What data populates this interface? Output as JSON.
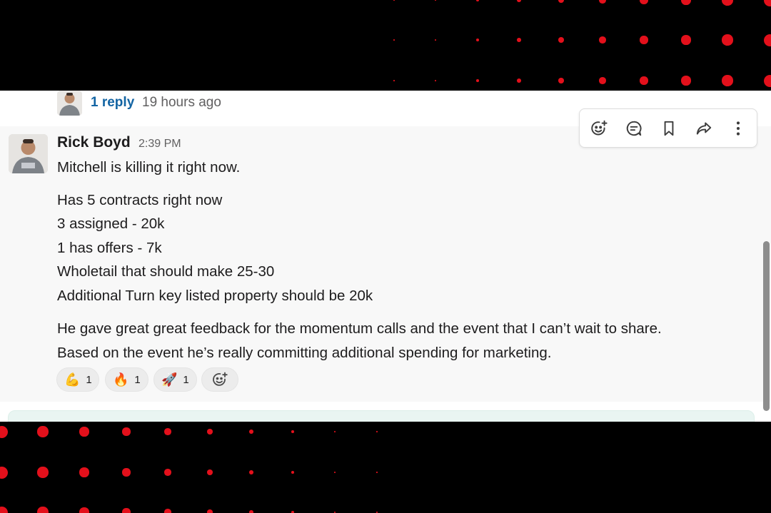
{
  "thread_preview": {
    "reply_link": "1 reply",
    "time": "19 hours ago"
  },
  "message": {
    "author": "Rick Boyd",
    "timestamp": "2:39 PM",
    "lines": [
      "Mitchell is killing it right now.",
      "Has 5 contracts right now",
      "3 assigned - 20k",
      "1 has offers - 7k",
      "Wholetail that should make 25-30",
      "Additional Turn key listed property should be 20k",
      "He gave great great feedback for the momentum calls and the event that I can’t wait to share.",
      "Based on the event he’s really committing additional spending for marketing."
    ]
  },
  "reactions": [
    {
      "emoji": "💪",
      "count": "1"
    },
    {
      "emoji": "🔥",
      "count": "1"
    },
    {
      "emoji": "🚀",
      "count": "1"
    }
  ],
  "toolbar": {
    "icons": [
      "add-reaction-icon",
      "reply-in-thread-icon",
      "bookmark-icon",
      "share-icon",
      "more-actions-icon"
    ]
  },
  "colors": {
    "accent_dots": "#e3101b",
    "link": "#1264a3",
    "message_bg": "#f8f8f8"
  }
}
